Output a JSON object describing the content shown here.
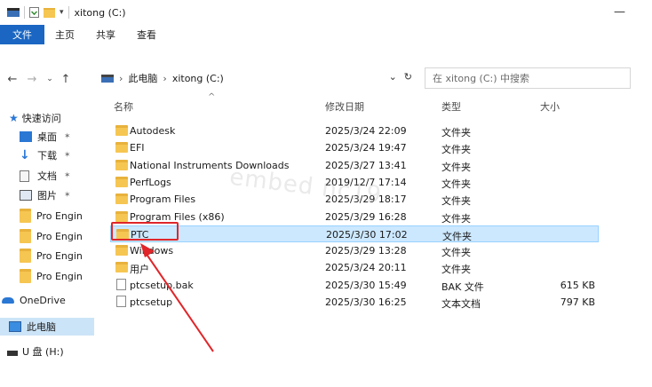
{
  "window": {
    "title": "xitong (C:)"
  },
  "ribbon": {
    "tabs": [
      "文件",
      "主页",
      "共享",
      "查看"
    ]
  },
  "address": {
    "path": [
      "此电脑",
      "xitong (C:)"
    ],
    "search_placeholder": "在 xitong (C:) 中搜索"
  },
  "columns": {
    "name": "名称",
    "date": "修改日期",
    "type": "类型",
    "size": "大小"
  },
  "nav": {
    "items": [
      {
        "label": "快速访问",
        "icon": "star-icon"
      },
      {
        "label": "桌面",
        "icon": "desktop-icon",
        "pinned": true
      },
      {
        "label": "下载",
        "icon": "download-icon",
        "pinned": true
      },
      {
        "label": "文档",
        "icon": "document-icon",
        "pinned": true
      },
      {
        "label": "图片",
        "icon": "picture-icon",
        "pinned": true
      },
      {
        "label": "Pro Engin",
        "icon": "folder-icon"
      },
      {
        "label": "Pro Engin",
        "icon": "folder-icon"
      },
      {
        "label": "Pro Engin",
        "icon": "folder-icon"
      },
      {
        "label": "Pro Engin",
        "icon": "folder-icon"
      },
      {
        "label": "OneDrive",
        "icon": "cloud-icon"
      },
      {
        "label": "此电脑",
        "icon": "computer-icon"
      },
      {
        "label": "U 盘 (H:)",
        "icon": "usb-drive-icon"
      }
    ]
  },
  "files": [
    {
      "name": "Autodesk",
      "date": "2025/3/24 22:09",
      "type": "文件夹",
      "size": "",
      "kind": "folder"
    },
    {
      "name": "EFI",
      "date": "2025/3/24 19:47",
      "type": "文件夹",
      "size": "",
      "kind": "folder"
    },
    {
      "name": "National Instruments Downloads",
      "date": "2025/3/27 13:41",
      "type": "文件夹",
      "size": "",
      "kind": "folder"
    },
    {
      "name": "PerfLogs",
      "date": "2019/12/7 17:14",
      "type": "文件夹",
      "size": "",
      "kind": "folder"
    },
    {
      "name": "Program Files",
      "date": "2025/3/29 18:17",
      "type": "文件夹",
      "size": "",
      "kind": "folder"
    },
    {
      "name": "Program Files (x86)",
      "date": "2025/3/29 16:28",
      "type": "文件夹",
      "size": "",
      "kind": "folder"
    },
    {
      "name": "PTC",
      "date": "2025/3/30 17:02",
      "type": "文件夹",
      "size": "",
      "kind": "folder",
      "selected": true
    },
    {
      "name": "Windows",
      "date": "2025/3/29 13:28",
      "type": "文件夹",
      "size": "",
      "kind": "folder"
    },
    {
      "name": "用户",
      "date": "2025/3/24 20:11",
      "type": "文件夹",
      "size": "",
      "kind": "folder"
    },
    {
      "name": "ptcsetup.bak",
      "date": "2025/3/30 15:49",
      "type": "BAK 文件",
      "size": "615 KB",
      "kind": "file"
    },
    {
      "name": "ptcsetup",
      "date": "2025/3/30 16:25",
      "type": "文本文档",
      "size": "797 KB",
      "kind": "text"
    }
  ],
  "colors": {
    "accent": "#1a66c2",
    "highlight": "#e0262a",
    "selection": "#cce8ff",
    "folder": "#f6c652"
  }
}
